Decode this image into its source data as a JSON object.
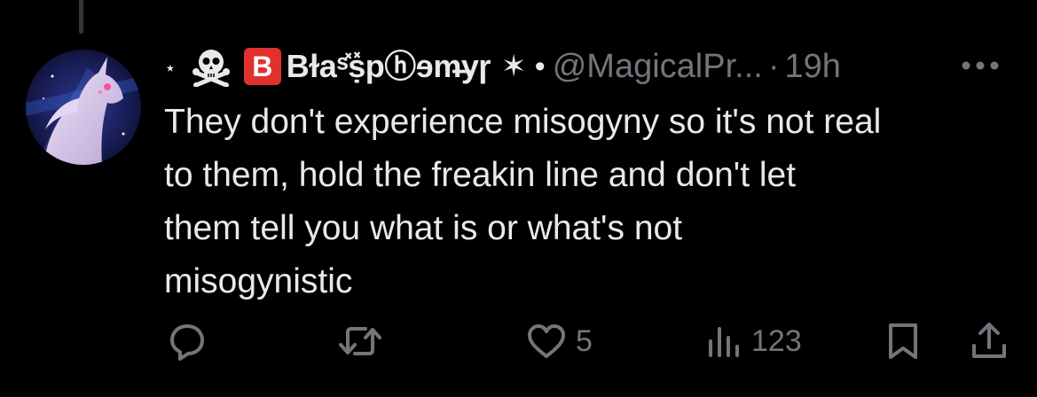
{
  "author": {
    "prefix_symbol": "⋆",
    "name": "B​ɫaˢ̽ṣ̽pⓗɘm̶yɼ",
    "name_suffix": "✶ •",
    "handle": "@MagicalPr...",
    "separator": "·",
    "time": "19h"
  },
  "tweet": {
    "text": "They don't experience misogyny so it's not real\nto them, hold the freakin line and don't let\nthem tell you what is or what's not\nmisogynistic"
  },
  "actions": {
    "reply_count": "",
    "retweet_count": "",
    "like_count": "5",
    "views_count": "123"
  },
  "colors": {
    "background": "#000000",
    "text": "#e7e9ea",
    "muted": "#71767b",
    "badge": "#e0312f"
  }
}
